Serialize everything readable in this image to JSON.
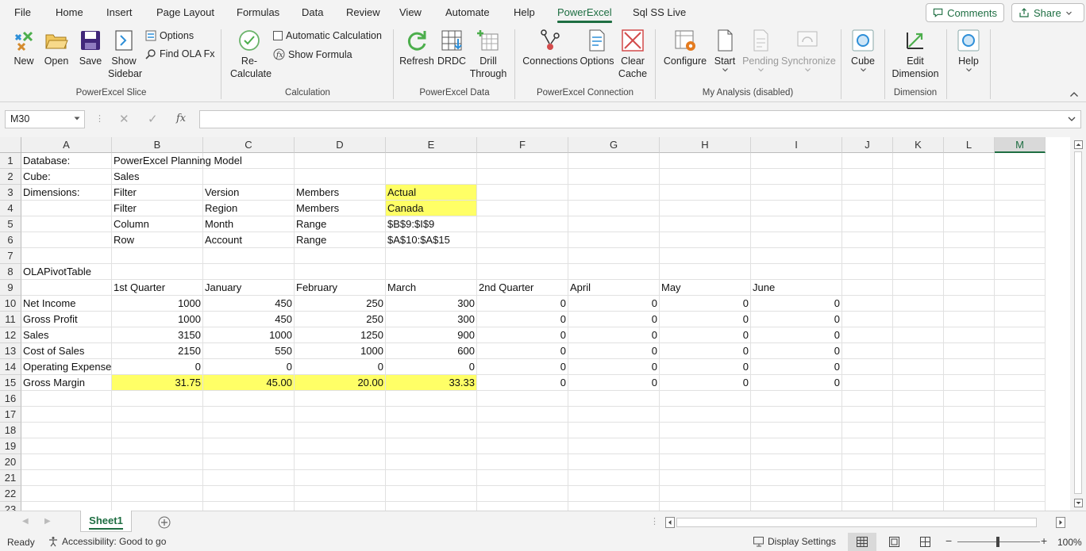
{
  "menu": {
    "tabs": [
      "File",
      "Home",
      "Insert",
      "Page Layout",
      "Formulas",
      "Data",
      "Review",
      "View",
      "Automate",
      "Help",
      "PowerExcel",
      "Sql SS Live"
    ],
    "active": "PowerExcel",
    "comments_label": "Comments",
    "share_label": "Share"
  },
  "ribbon": {
    "slice": {
      "new": "New",
      "open": "Open",
      "save": "Save",
      "show_sidebar_1": "Show",
      "show_sidebar_2": "Sidebar",
      "options": "Options",
      "find_ola": "Find OLA Fx",
      "group": "PowerExcel Slice"
    },
    "calculation": {
      "recalc_1": "Re-",
      "recalc_2": "Calculate",
      "automatic": "Automatic Calculation",
      "show_formula": "Show Formula",
      "group": "Calculation"
    },
    "data": {
      "refresh": "Refresh",
      "drdc": "DRDC",
      "drill_1": "Drill",
      "drill_2": "Through",
      "group": "PowerExcel Data"
    },
    "connection": {
      "connections": "Connections",
      "options": "Options",
      "clear_1": "Clear",
      "clear_2": "Cache",
      "group": "PowerExcel Connection"
    },
    "analysis": {
      "configure": "Configure",
      "start": "Start",
      "pending": "Pending",
      "synchronize": "Synchronize",
      "group": "My Analysis (disabled)"
    },
    "cube": {
      "cube": "Cube"
    },
    "dimension": {
      "edit_1": "Edit",
      "edit_2": "Dimension",
      "group": "Dimension"
    },
    "help": {
      "help": "Help"
    }
  },
  "formula_bar": {
    "name_box": "M30",
    "fx": "fx",
    "value": ""
  },
  "grid": {
    "columns": [
      "A",
      "B",
      "C",
      "D",
      "E",
      "F",
      "G",
      "H",
      "I",
      "J",
      "K",
      "L",
      "M"
    ],
    "selected_column": "M",
    "rows": [
      "1",
      "2",
      "3",
      "4",
      "5",
      "6",
      "7",
      "8",
      "9",
      "10",
      "11",
      "12",
      "13",
      "14",
      "15",
      "16",
      "17",
      "18",
      "19",
      "20",
      "21",
      "22",
      "23"
    ],
    "cells": {
      "A1": "Database:",
      "B1": "PowerExcel Planning Model",
      "A2": "Cube:",
      "B2": "Sales",
      "A3": "Dimensions:",
      "B3": "Filter",
      "C3": "Version",
      "D3": "Members",
      "E3": "Actual",
      "B4": "Filter",
      "C4": "Region",
      "D4": "Members",
      "E4": "Canada",
      "B5": "Column",
      "C5": "Month",
      "D5": "Range",
      "E5": "$B$9:$I$9",
      "B6": "Row",
      "C6": "Account",
      "D6": "Range",
      "E6": "$A$10:$A$15",
      "A8": "OLAPivotTable",
      "B9": "1st Quarter",
      "C9": "January",
      "D9": "February",
      "E9": "March",
      "F9": "2nd Quarter",
      "G9": "April",
      "H9": "May",
      "I9": "June",
      "A10": "Net Income",
      "B10": "1000",
      "C10": "450",
      "D10": "250",
      "E10": "300",
      "F10": "0",
      "G10": "0",
      "H10": "0",
      "I10": "0",
      "A11": "Gross Profit",
      "B11": "1000",
      "C11": "450",
      "D11": "250",
      "E11": "300",
      "F11": "0",
      "G11": "0",
      "H11": "0",
      "I11": "0",
      "A12": "Sales",
      "B12": "3150",
      "C12": "1000",
      "D12": "1250",
      "E12": "900",
      "F12": "0",
      "G12": "0",
      "H12": "0",
      "I12": "0",
      "A13": "Cost of Sales",
      "B13": "2150",
      "C13": "550",
      "D13": "1000",
      "E13": "600",
      "F13": "0",
      "G13": "0",
      "H13": "0",
      "I13": "0",
      "A14": "Operating Expense",
      "B14": "0",
      "C14": "0",
      "D14": "0",
      "E14": "0",
      "F14": "0",
      "G14": "0",
      "H14": "0",
      "I14": "0",
      "A15": "Gross Margin",
      "B15": "31.75",
      "C15": "45.00",
      "D15": "20.00",
      "E15": "33.33",
      "F15": "0",
      "G15": "0",
      "H15": "0",
      "I15": "0"
    },
    "highlight_color": "#ffff66"
  },
  "sheets": {
    "active": "Sheet1"
  },
  "status": {
    "ready": "Ready",
    "accessibility": "Accessibility: Good to go",
    "display_settings": "Display Settings",
    "zoom": "100%"
  },
  "colors": {
    "accent": "#1e6e42"
  }
}
